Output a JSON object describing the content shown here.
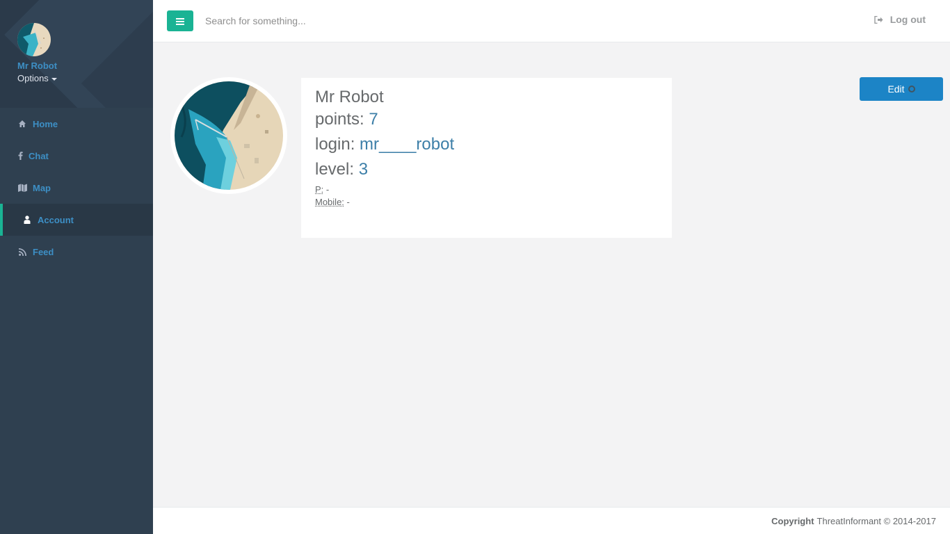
{
  "sidebar": {
    "profile_name": "Mr Robot",
    "options_label": "Options",
    "items": [
      {
        "label": "Home",
        "icon": "home-icon"
      },
      {
        "label": "Chat",
        "icon": "facebook-icon"
      },
      {
        "label": "Map",
        "icon": "map-icon"
      },
      {
        "label": "Account",
        "icon": "user-icon",
        "active": true
      },
      {
        "label": "Feed",
        "icon": "rss-icon"
      }
    ]
  },
  "topbar": {
    "search_placeholder": "Search for something...",
    "logout_label": "Log out"
  },
  "profile": {
    "name": "Mr Robot",
    "points_label": "points: ",
    "points_value": "7",
    "login_label": "login: ",
    "login_value": "mr____robot",
    "level_label": "level: ",
    "level_value": "3",
    "phone_label": "P:",
    "phone_value": " -",
    "mobile_label": "Mobile:",
    "mobile_value": " -"
  },
  "edit_label": "Edit",
  "footer": {
    "copyright_label": "Copyright",
    "copyright_text": "ThreatInformant © 2014-2017"
  },
  "colors": {
    "sidebar_bg": "#2f4050",
    "accent_green": "#1ab394",
    "link_blue": "#3d8fc5",
    "button_blue": "#1c84c6"
  }
}
